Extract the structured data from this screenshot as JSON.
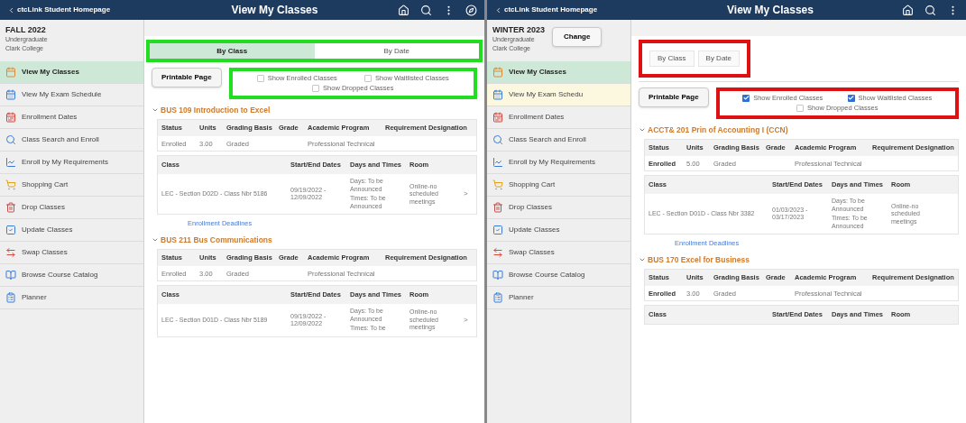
{
  "panels": [
    {
      "color": "#22dd22",
      "header": {
        "back_link": "ctcLink Student Homepage",
        "title": "View My Classes",
        "compass_button": true
      },
      "term": {
        "name": "FALL 2022",
        "career": "Undergraduate",
        "institution": "Clark College"
      },
      "sidebar": {
        "items": [
          {
            "label": "View My Classes",
            "selected": true,
            "hovered": false
          },
          {
            "label": "View My Exam Schedule",
            "selected": false,
            "hovered": false
          },
          {
            "label": "Enrollment Dates",
            "selected": false,
            "hovered": false
          },
          {
            "label": "Class Search and Enroll",
            "selected": false,
            "hovered": false
          },
          {
            "label": "Enroll by My Requirements",
            "selected": false,
            "hovered": false
          },
          {
            "label": "Shopping Cart",
            "selected": false,
            "hovered": false
          },
          {
            "label": "Drop Classes",
            "selected": false,
            "hovered": false
          },
          {
            "label": "Update Classes",
            "selected": false,
            "hovered": false
          },
          {
            "label": "Swap Classes",
            "selected": false,
            "hovered": false
          },
          {
            "label": "Browse Course Catalog",
            "selected": false,
            "hovered": false
          },
          {
            "label": "Planner",
            "selected": false,
            "hovered": false
          }
        ]
      },
      "tabs": {
        "kind": "segmented",
        "items": [
          {
            "label": "By Class",
            "selected": true
          },
          {
            "label": "By Date",
            "selected": false
          }
        ]
      },
      "printable_button": "Printable Page",
      "filters": [
        {
          "label": "Show Enrolled Classes",
          "checked": false
        },
        {
          "label": "Show Waitlisted Classes",
          "checked": false
        },
        {
          "label": "Show Dropped Classes",
          "checked": false
        }
      ],
      "courses": [
        {
          "title": "BUS 109 Introduction to Excel",
          "status_columns": [
            "Status",
            "Units",
            "Grading Basis",
            "Grade",
            "Academic Program",
            "Requirement Designation"
          ],
          "status_row": {
            "status": "Enrolled",
            "status_bold": false,
            "units": "3.00",
            "grading_basis": "Graded",
            "academic_program": "Professional Technical"
          },
          "class_columns": [
            "Class",
            "Start/End Dates",
            "Days and Times",
            "Room"
          ],
          "class_rows": [
            {
              "class": "LEC - Section D02D - Class Nbr 5186",
              "dates": "09/19/2022 - 12/09/2022",
              "days": "Days: To be Announced",
              "times": "Times: To be Announced",
              "room": "Online-no scheduled meetings",
              "chevron": ">"
            }
          ],
          "link": "Enrollment Deadlines"
        },
        {
          "title": "BUS 211 Bus Communications",
          "status_columns": [
            "Status",
            "Units",
            "Grading Basis",
            "Grade",
            "Academic Program",
            "Requirement Designation"
          ],
          "status_row": {
            "status": "Enrolled",
            "status_bold": false,
            "units": "3.00",
            "grading_basis": "Graded",
            "academic_program": "Professional Technical"
          },
          "class_columns": [
            "Class",
            "Start/End Dates",
            "Days and Times",
            "Room"
          ],
          "class_rows": [
            {
              "class": "LEC - Section D01D - Class Nbr 5189",
              "dates": "09/19/2022 - 12/09/2022",
              "days": "Days: To be Announced",
              "times": "Times: To be",
              "room": "Online-no scheduled meetings",
              "chevron": ">"
            }
          ]
        }
      ]
    },
    {
      "color": "#dd1111",
      "header": {
        "back_link": "ctcLink Student Homepage",
        "title": "View My Classes",
        "compass_button": false
      },
      "term": {
        "name": "WINTER 2023",
        "career": "Undergraduate",
        "institution": "Clark College",
        "change_button": "Change"
      },
      "sidebar": {
        "items": [
          {
            "label": "View My Classes",
            "selected": true,
            "hovered": false
          },
          {
            "label": "View My Exam Schedu",
            "selected": false,
            "hovered": true
          },
          {
            "label": "Enrollment Dates",
            "selected": false,
            "hovered": false
          },
          {
            "label": "Class Search and Enroll",
            "selected": false,
            "hovered": false
          },
          {
            "label": "Enroll by My Requirements",
            "selected": false,
            "hovered": false
          },
          {
            "label": "Shopping Cart",
            "selected": false,
            "hovered": false
          },
          {
            "label": "Drop Classes",
            "selected": false,
            "hovered": false
          },
          {
            "label": "Update Classes",
            "selected": false,
            "hovered": false
          },
          {
            "label": "Swap Classes",
            "selected": false,
            "hovered": false
          },
          {
            "label": "Browse Course Catalog",
            "selected": false,
            "hovered": false
          },
          {
            "label": "Planner",
            "selected": false,
            "hovered": false
          }
        ]
      },
      "tabs": {
        "kind": "tabs",
        "items": [
          {
            "label": "By Class",
            "selected": false
          },
          {
            "label": "By Date",
            "selected": false
          }
        ]
      },
      "printable_button": "Printable Page",
      "filters": [
        {
          "label": "Show Enrolled Classes",
          "checked": true
        },
        {
          "label": "Show Waitlisted Classes",
          "checked": true
        },
        {
          "label": "Show Dropped Classes",
          "checked": false
        }
      ],
      "courses": [
        {
          "title": "ACCT& 201 Prin of Accounting I (CCN)",
          "status_columns": [
            "Status",
            "Units",
            "Grading Basis",
            "Grade",
            "Academic Program",
            "Requirement Designation"
          ],
          "status_row": {
            "status": "Enrolled",
            "status_bold": true,
            "units": "5.00",
            "grading_basis": "Graded",
            "academic_program": "Professional Technical"
          },
          "class_columns": [
            "Class",
            "Start/End Dates",
            "Days and Times",
            "Room"
          ],
          "class_rows": [
            {
              "class": "LEC - Section D01D - Class Nbr 3382",
              "dates": "01/03/2023 - 03/17/2023",
              "days": "Days: To be Announced",
              "times": "Times: To be Announced",
              "room": "Online-no scheduled meetings"
            }
          ],
          "link": "Enrollment Deadlines"
        },
        {
          "title": "BUS 170 Excel for Business",
          "status_columns": [
            "Status",
            "Units",
            "Grading Basis",
            "Grade",
            "Academic Program",
            "Requirement Designation"
          ],
          "status_row": {
            "status": "Enrolled",
            "status_bold": true,
            "units": "3.00",
            "grading_basis": "Graded",
            "academic_program": "Professional Technical"
          },
          "class_columns": [
            "Class",
            "Start/End Dates",
            "Days and Times",
            "Room"
          ]
        }
      ]
    }
  ]
}
